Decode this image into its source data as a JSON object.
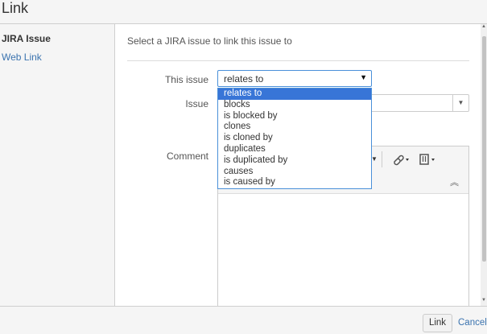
{
  "dialog": {
    "title": "Link"
  },
  "sidebar": {
    "items": [
      {
        "label": "JIRA Issue"
      },
      {
        "label": "Web Link"
      }
    ]
  },
  "form": {
    "intro": "Select a JIRA issue to link this issue to",
    "this_issue_label": "This issue",
    "issue_label": "Issue",
    "comment_label": "Comment",
    "relation_value": "relates to"
  },
  "relation_options": [
    "relates to",
    "blocks",
    "is blocked by",
    "clones",
    "is cloned by",
    "duplicates",
    "is duplicated by",
    "causes",
    "is caused by"
  ],
  "footer": {
    "link_button": "Link",
    "cancel": "Cancel"
  },
  "icons": {
    "dropdown_arrow": "caret-down-icon",
    "link": "link-icon",
    "attachment": "attachment-icon",
    "collapse": "collapse-up-icon"
  },
  "colors": {
    "accent": "#3b73af",
    "focus_border": "#4a90d9",
    "selected_option": "#3875d7"
  }
}
